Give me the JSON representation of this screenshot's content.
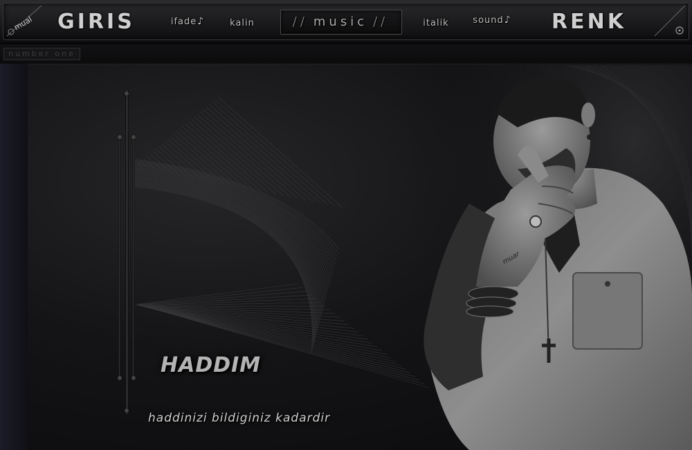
{
  "nav": {
    "giris": "GIRIS",
    "ifade": "ifade",
    "kalin": "kalin",
    "music": "music",
    "italik": "italik",
    "sound": "sound",
    "renk": "RENK"
  },
  "logo_text": "mual",
  "subbar_label": "number one",
  "hand_text": "muar",
  "title": "HADDIM",
  "subtitle": "haddinizi bildiginiz kadardir",
  "colors": {
    "accent": "#cfcfcf",
    "background": "#141416",
    "bar": "#1e1e20"
  },
  "icons": {
    "logo": "mual-logo-icon",
    "corner": "target-icon"
  }
}
